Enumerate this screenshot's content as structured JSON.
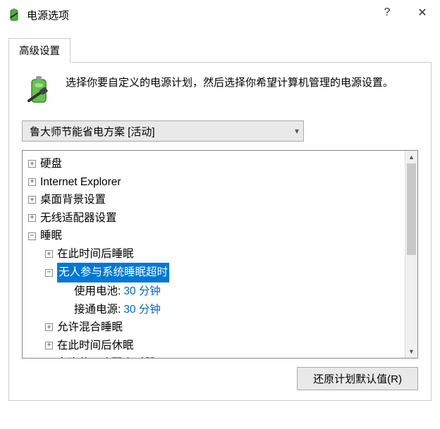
{
  "window": {
    "title": "电源选项",
    "help_glyph": "?",
    "close_glyph": "✕"
  },
  "tab": {
    "label": "高级设置"
  },
  "description": "选择你要自定义的电源计划，然后选择你希望计算机管理的电源设置。",
  "plan_select": {
    "value": "鲁大师节能省电方案 [活动]"
  },
  "tree": {
    "items": [
      {
        "label": "硬盘",
        "expanded": false,
        "level": 0
      },
      {
        "label": "Internet Explorer",
        "expanded": false,
        "level": 0
      },
      {
        "label": "桌面背景设置",
        "expanded": false,
        "level": 0
      },
      {
        "label": "无线适配器设置",
        "expanded": false,
        "level": 0
      },
      {
        "label": "睡眠",
        "expanded": true,
        "level": 0
      },
      {
        "label": "在此时间后睡眠",
        "expanded": false,
        "level": 1
      },
      {
        "label": "无人参与系统睡眠超时",
        "expanded": true,
        "level": 1,
        "selected": true
      },
      {
        "label": "使用电池:",
        "value": "30 分钟",
        "leaf": true,
        "level": 2
      },
      {
        "label": "接通电源:",
        "value": "30 分钟",
        "leaf": true,
        "level": 2
      },
      {
        "label": "允许混合睡眠",
        "expanded": false,
        "level": 1
      },
      {
        "label": "在此时间后休眠",
        "expanded": false,
        "level": 1
      },
      {
        "label": "允许使用唤醒定时器",
        "expanded": false,
        "level": 1
      }
    ]
  },
  "restore_button": "还原计划默认值(R)"
}
